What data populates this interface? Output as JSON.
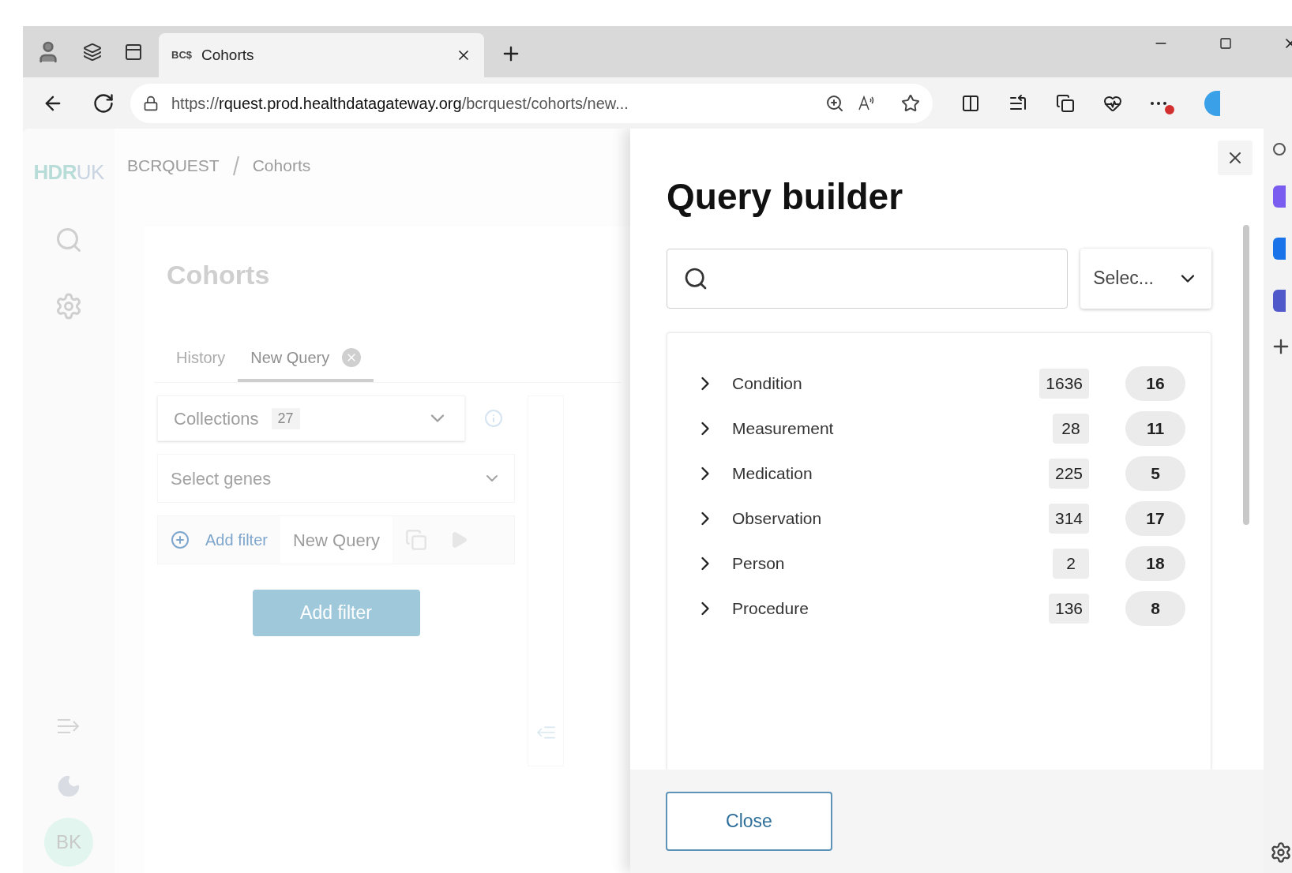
{
  "browser": {
    "tabs": [
      {
        "favicon": "BC$",
        "label": "Cohorts",
        "selected": true
      }
    ],
    "url": {
      "scheme": "https://",
      "host": "rquest.prod.healthdatagateway.org",
      "path": "/bcrquest/cohorts/new..."
    }
  },
  "sidebar": {
    "logo_parts": [
      "HDR",
      "UK"
    ],
    "avatar": "BK"
  },
  "breadcrumb": [
    "BCRQUEST",
    "Cohorts"
  ],
  "page_title": "Cohorts",
  "tabs": [
    {
      "label": "History",
      "selected": false
    },
    {
      "label": "New Query",
      "selected": true
    }
  ],
  "collections": {
    "label": "Collections",
    "count": "27"
  },
  "genes": {
    "placeholder": "Select genes"
  },
  "toolbar": {
    "add_filter": "Add filter",
    "query_name": "New Query"
  },
  "add_filter_button": "Add filter",
  "modal": {
    "title": "Query builder",
    "select": "Selec...",
    "items": [
      {
        "name": "Condition",
        "count": "1636",
        "count_2": "16",
        "expanded": false
      },
      {
        "name": "Measurement",
        "count": "28",
        "count_2": "11",
        "expanded": false
      },
      {
        "name": "Medication",
        "count": "225",
        "count_2": "5",
        "expanded": false
      },
      {
        "name": "Observation",
        "count": "314",
        "count_2": "17",
        "expanded": false
      },
      {
        "name": "Person",
        "count": "2",
        "count_2": "18",
        "expanded": false
      },
      {
        "name": "Procedure",
        "count": "136",
        "count_2": "8",
        "expanded": false
      }
    ],
    "close_button": "Close"
  }
}
